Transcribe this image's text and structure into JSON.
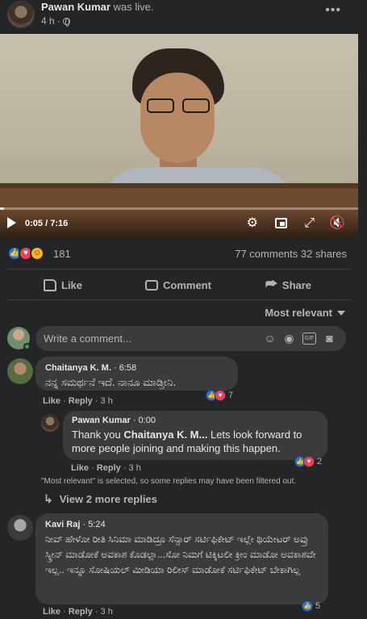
{
  "post": {
    "author": "Pawan Kumar",
    "action": "was live.",
    "time": "4 h",
    "more_icon": "more-horizontal-icon"
  },
  "video": {
    "time_current": "0:05",
    "time_total": "7:16",
    "time_separator": " / ",
    "progress_fraction": 0.0115
  },
  "stats": {
    "reaction_count": "181",
    "comments": "77 comments",
    "shares": "32 shares"
  },
  "actions": {
    "like": "Like",
    "comment": "Comment",
    "share": "Share"
  },
  "sort_label": "Most relevant",
  "composer": {
    "placeholder": "Write a comment..."
  },
  "comments": [
    {
      "author": "Chaitanya K. M.",
      "time": "6:58",
      "text": "ನನ್ನ ಸಮರ್ಥನೆ ಇದೆ. ನಾನೂ ಮಾಡ್ತೀನಿ.",
      "like": "Like",
      "reply": "Reply",
      "age": "3 h",
      "reactions": "7"
    },
    {
      "author": "Pawan Kumar",
      "time": "0:00",
      "text_prefix": "Thank you ",
      "mention": "Chaitanya K. M...",
      "text_suffix": " Lets look forward to more people joining and making this happen.",
      "like": "Like",
      "reply": "Reply",
      "age": "3 h",
      "reactions": "2"
    },
    {
      "author": "Kavi Raj",
      "time": "5:24",
      "text": "ನೀವ್ ಹೇಳೋ ರೀತಿ ಸಿನಿಮಾ ಮಾಡಿದ್ರೂ ಸೆನ್ಸಾರ್ ಸರ್ಟಿಫಿಕೇಟ್ ಇಲ್ಲೇ ಥಿಯೇಟರ್ ಅವ್ರು ಸ್ಕ್ರೀನ್ ಮಾಡೋಕೆ ಅವಕಾಶ ಕೊಡಲ್ಲಾ...ಸೋ ನಿಮಗೆ ಟಿಕ್ಕಿಟಲೀ ಕ್ರೀಂ ಮಾಡೋ ಅವಕಾಶವೇ ಇಲ್ಲ.. ಇನ್ನೂ ಸೋಷಿಯಲ್ ಮೀಡಿಯಾ ರಿಲೀಸ್ ಮಾಡೋಕೆ ಸರ್ಟಿಫಿಕೇಟ್ ಬೇಕಾಗಿಲ್ಲ",
      "like": "Like",
      "reply": "Reply",
      "age": "3 h",
      "reactions": "5"
    }
  ],
  "filter_note": "\"Most relevant\" is selected, so some replies may have been filtered out.",
  "view_more_replies": "View 2 more replies",
  "colors": {
    "background": "#242526",
    "bubble": "#3a3b3c",
    "like_blue": "#1877f2",
    "love_red": "#f33e58",
    "haha_yellow": "#f7b125"
  }
}
